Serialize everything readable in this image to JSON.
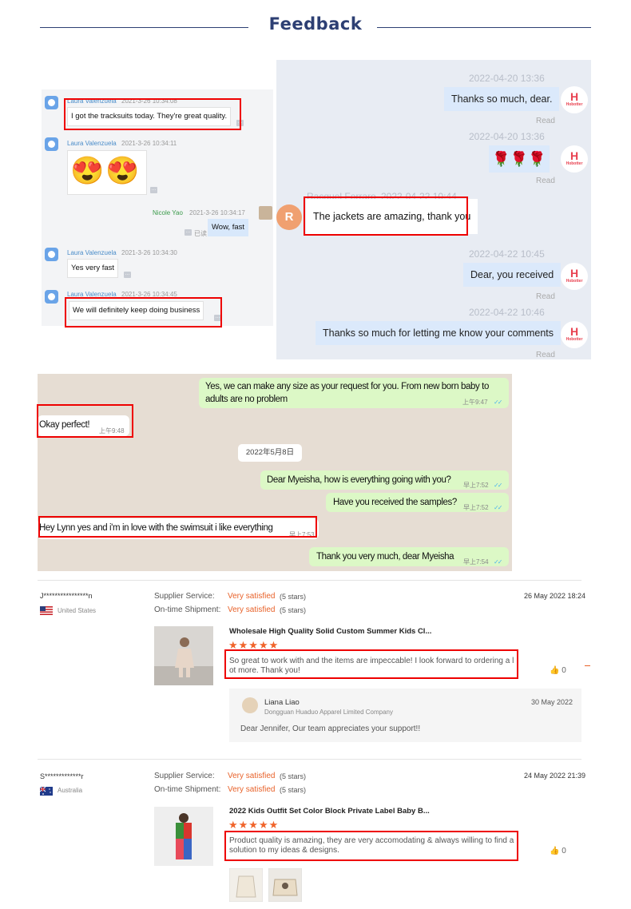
{
  "header": {
    "title": "Feedback"
  },
  "chat_a": {
    "messages": [
      {
        "name": "Laura Valenzuela",
        "time": "2021-3-26 10:34:08",
        "text": "I got the tracksuits today. They're great quality."
      },
      {
        "name": "Laura Valenzuela",
        "time": "2021-3-26 10:34:11",
        "emoji": "😍😍"
      },
      {
        "name": "Nicole Yao",
        "time": "2021-3-26 10:34:17",
        "text": "Wow, fast",
        "status": "已读"
      },
      {
        "name": "Laura Valenzuela",
        "time": "2021-3-26 10:34:30",
        "text": "Yes very fast"
      },
      {
        "name": "Laura Valenzuela",
        "time": "2021-3-26 10:34:45",
        "text": "We will definitely keep doing business"
      }
    ]
  },
  "chat_b": {
    "messages": [
      {
        "time": "2022-04-20 13:36",
        "text": "Thanks so much, dear.",
        "read": "Read"
      },
      {
        "time": "2022-04-20 13:36",
        "emoji": "🌹🌹🌹",
        "read": "Read"
      },
      {
        "name": "Racquel Ferraro",
        "time": "2022-04-22 10:44",
        "text": "The jackets are amazing, thank you",
        "avatar_letter": "R"
      },
      {
        "time": "2022-04-22 10:45",
        "text": "Dear, you received",
        "read": "Read"
      },
      {
        "time": "2022-04-22 10:46",
        "text": "Thanks so much for letting me know your comments",
        "read": "Read"
      }
    ],
    "logo": {
      "glyph": "H",
      "label": "Hobotter"
    }
  },
  "whatsapp": {
    "messages": [
      {
        "dir": "out",
        "line1": "Yes, we can make any size as your request for you. From new born baby to",
        "line2": "adults are no problem",
        "time": "上午9:47"
      },
      {
        "dir": "in",
        "text": "Okay perfect!",
        "time": "上午9:48"
      },
      {
        "dir": "date",
        "text": "2022年5月8日"
      },
      {
        "dir": "out",
        "text": "Dear Myeisha, how is everything going with you?",
        "time": "早上7:52"
      },
      {
        "dir": "out",
        "text": "Have you received the samples?",
        "time": "早上7:52"
      },
      {
        "dir": "in",
        "text": "Hey Lynn yes and i'm in love with the swimsuit i like everything",
        "time": "早上7:53"
      },
      {
        "dir": "out",
        "text": "Thank you very much, dear Myeisha",
        "time": "早上7:54"
      }
    ]
  },
  "reviews": [
    {
      "name": "J****************n",
      "country": "United States",
      "supplier_label": "Supplier Service:",
      "supplier_value": "Very satisfied",
      "supplier_stars": "(5 stars)",
      "shipment_label": "On-time Shipment:",
      "shipment_value": "Very satisfied",
      "shipment_stars": "(5 stars)",
      "date": "26 May 2022 18:24",
      "product": "Wholesale High Quality Solid Custom Summer Kids Cl...",
      "stars": "★★★★★",
      "text_line1": "So great to work with and the items are impeccable! I look forward to ordering a l",
      "text_line2": "ot more. Thank you!",
      "likes": "0",
      "reply": {
        "name": "Liana Liao",
        "company": "Dongguan Huaduo Apparel Limited Company",
        "date": "30 May 2022",
        "text": "Dear Jennifer, Our team appreciates your support!!"
      }
    },
    {
      "name": "S*************r",
      "country": "Australia",
      "supplier_label": "Supplier Service:",
      "supplier_value": "Very satisfied",
      "supplier_stars": "(5 stars)",
      "shipment_label": "On-time Shipment:",
      "shipment_value": "Very satisfied",
      "shipment_stars": "(5 stars)",
      "date": "24 May 2022 21:39",
      "product": "2022 Kids Outfit Set Color Block Private Label Baby B...",
      "stars": "★★★★★",
      "text_line1": "Product quality is amazing, they are very accomodating & always willing to find a",
      "text_line2": "solution to my ideas & designs.",
      "likes": "0"
    }
  ]
}
